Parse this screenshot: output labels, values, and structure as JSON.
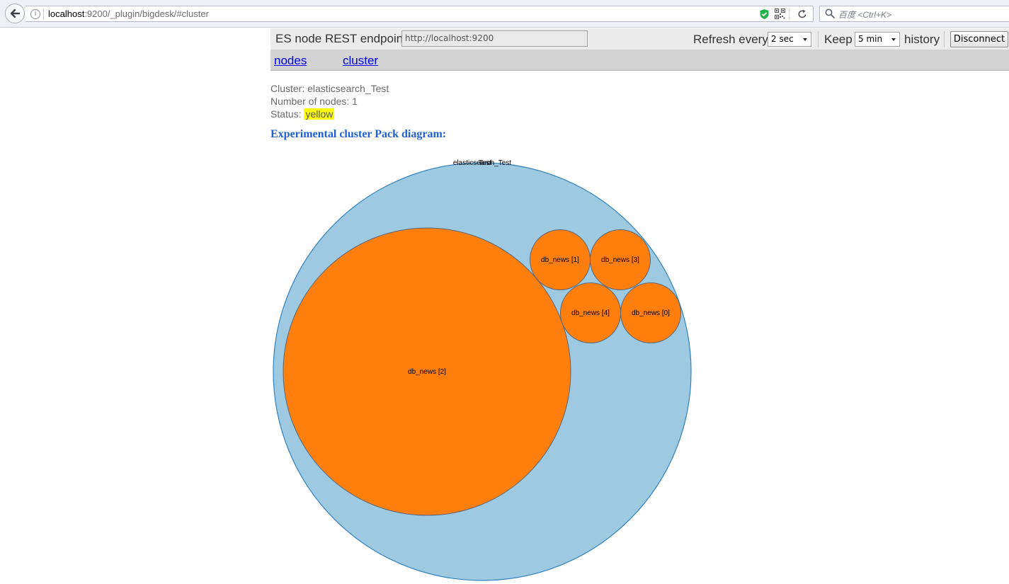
{
  "browser": {
    "url_host": "localhost",
    "url_rest": ":9200/_plugin/bigdesk/#cluster",
    "search_placeholder": "百度 <Ctrl+K>"
  },
  "header": {
    "endpoint_label": "ES node REST endpoint",
    "endpoint_value": "http://localhost:9200",
    "refresh_label": "Refresh every",
    "refresh_value": "2 sec",
    "keep_label": "Keep",
    "keep_value": "5 min",
    "history_label": "history",
    "disconnect_label": "Disconnect"
  },
  "nav": {
    "nodes_label": "nodes",
    "cluster_label": "cluster"
  },
  "cluster_info": {
    "cluster_line": "Cluster: elasticsearch_Test",
    "nodes_line": "Number of nodes: 1",
    "status_prefix": "Status:",
    "status_value": "yellow",
    "status_color": "#ffff00"
  },
  "diagram": {
    "heading": "Experimental cluster Pack diagram:",
    "root_labels": [
      "elasticsearch_Test",
      "Test"
    ],
    "root_color": "#9ecae1",
    "root_stroke": "#3182bd",
    "shard_color": "#ff7f0e",
    "shard_stroke": "#58677a",
    "shards": [
      "db_news [2]",
      "db_news [1]",
      "db_news [3]",
      "db_news [4]",
      "db_news [0]"
    ],
    "shard_relative_sizes": [
      22.5,
      1,
      1,
      1,
      1
    ]
  }
}
